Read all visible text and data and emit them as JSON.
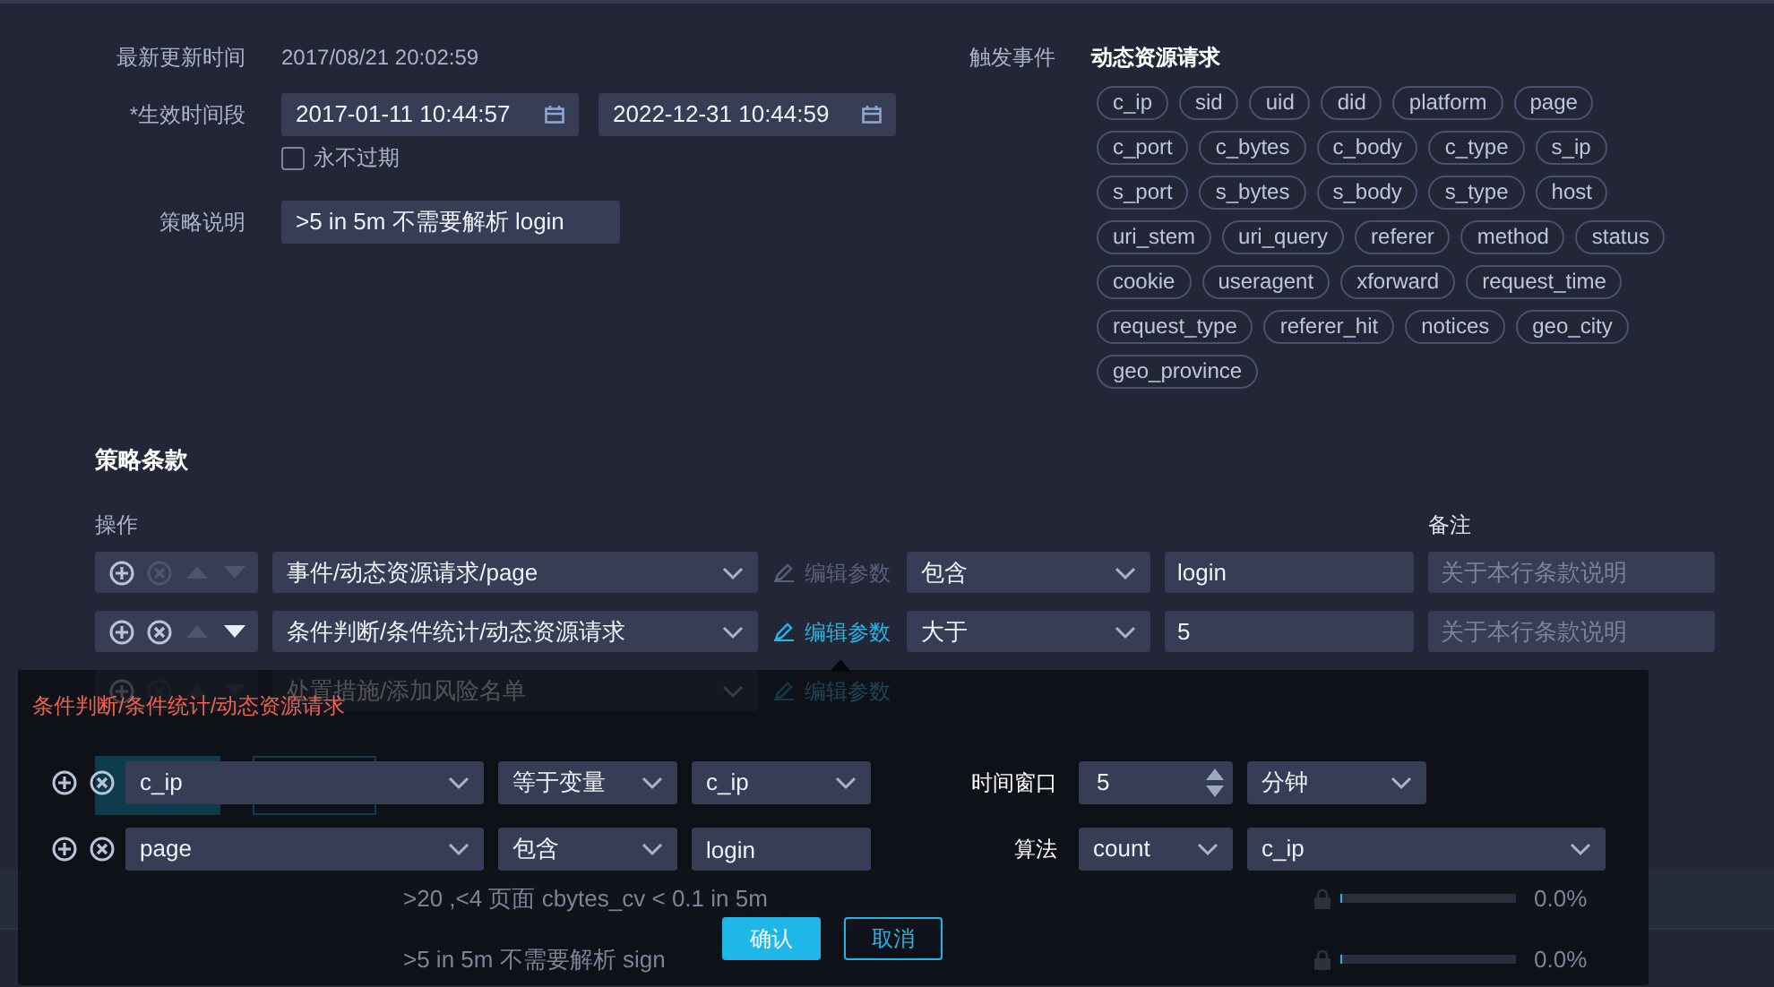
{
  "info": {
    "updated_label": "最新更新时间",
    "updated_value": "2017/08/21 20:02:59",
    "period_label": "*生效时间段",
    "start": "2017-01-11 10:44:57",
    "end": "2022-12-31 10:44:59",
    "never_expire": {
      "label": "永不过期",
      "checked": false
    },
    "desc_label": "策略说明",
    "desc_value": ">5 in 5m 不需要解析 login"
  },
  "trigger": {
    "label": "触发事件",
    "event": "动态资源请求",
    "field_rows": [
      [
        "c_ip",
        "sid",
        "uid",
        "did",
        "platform",
        "page"
      ],
      [
        "c_port",
        "c_bytes",
        "c_body",
        "c_type",
        "s_ip"
      ],
      [
        "s_port",
        "s_bytes",
        "s_body",
        "s_type",
        "host"
      ],
      [
        "uri_stem",
        "uri_query",
        "referer",
        "method",
        "status"
      ],
      [
        "cookie",
        "useragent",
        "xforward",
        "request_time"
      ],
      [
        "request_type",
        "referer_hit",
        "notices",
        "geo_city"
      ],
      [
        "geo_province"
      ]
    ]
  },
  "clauses": {
    "title": "策略条款",
    "op_header": "操作",
    "note_header": "备注",
    "rows": [
      {
        "kind": "condition",
        "add_enabled": true,
        "remove_enabled": false,
        "up_enabled": false,
        "down_enabled": false,
        "path": "事件/动态资源请求/page",
        "edit_label": "编辑参数",
        "edit_enabled": false,
        "operator": "包含",
        "value": "login",
        "note_placeholder": "关于本行条款说明"
      },
      {
        "kind": "condition",
        "add_enabled": true,
        "remove_enabled": true,
        "up_enabled": false,
        "down_enabled": true,
        "path": "条件判断/条件统计/动态资源请求",
        "edit_label": "编辑参数",
        "edit_enabled": true,
        "operator": "大于",
        "value": "5",
        "note_placeholder": "关于本行条款说明"
      },
      {
        "kind": "action",
        "add_enabled": true,
        "remove_enabled": false,
        "up_enabled": false,
        "down_enabled": false,
        "path": "处置措施/添加风险名单",
        "edit_label": "编辑参数",
        "edit_enabled": true
      }
    ]
  },
  "strategy_list": [
    {
      "description": ">20 ,<4 页面 cbytes_cv < 0.1 in 5m",
      "level": 0,
      "percent": "0.0%"
    },
    {
      "description": ">5 in 5m 不需要解析 sign",
      "level": 0,
      "percent": "0.0%"
    }
  ],
  "popup": {
    "title": "条件判断/条件统计/动态资源请求",
    "conditions": [
      {
        "field": "c_ip",
        "operator": "等于变量",
        "value": "c_ip",
        "kind": "select"
      },
      {
        "field": "page",
        "operator": "包含",
        "value": "login",
        "kind": "input"
      }
    ],
    "window_label": "时间窗口",
    "window_value": "5",
    "window_unit": "分钟",
    "algo_label": "算法",
    "algo": "count",
    "algo_field": "c_ip",
    "confirm": "确认",
    "cancel": "取消"
  }
}
